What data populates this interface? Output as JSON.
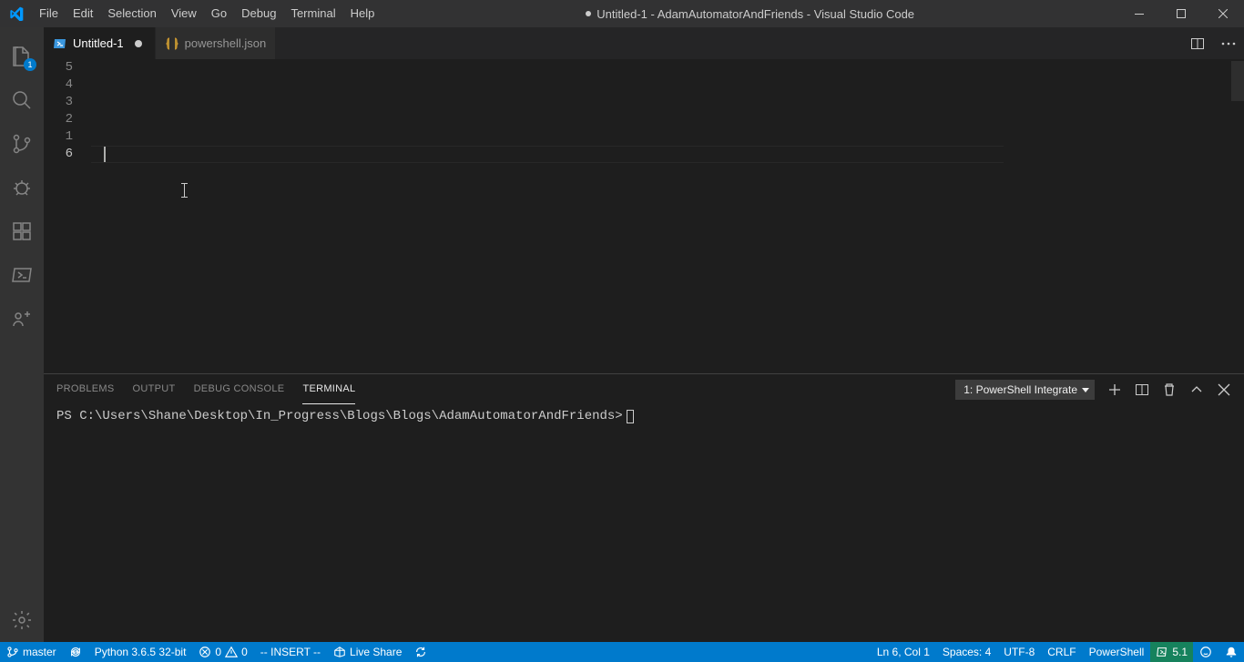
{
  "title_bar": {
    "menus": [
      "File",
      "Edit",
      "Selection",
      "View",
      "Go",
      "Debug",
      "Terminal",
      "Help"
    ],
    "title": "Untitled-1 - AdamAutomatorAndFriends - Visual Studio Code",
    "modified": true
  },
  "activity_bar": {
    "items": [
      {
        "name": "explorer-icon",
        "badge": "1"
      },
      {
        "name": "search-icon",
        "badge": null
      },
      {
        "name": "source-control-icon",
        "badge": null
      },
      {
        "name": "debug-icon",
        "badge": null
      },
      {
        "name": "extensions-icon",
        "badge": null
      },
      {
        "name": "powershell-icon",
        "badge": null
      },
      {
        "name": "live-share-icon",
        "badge": null
      }
    ],
    "bottom": [
      {
        "name": "settings-gear-icon"
      }
    ]
  },
  "tabs": [
    {
      "label": "Untitled-1",
      "icon": "powershell-file-icon",
      "active": true,
      "modified": true
    },
    {
      "label": "powershell.json",
      "icon": "json-file-icon",
      "active": false,
      "modified": false
    }
  ],
  "editor": {
    "line_numbers": [
      "5",
      "4",
      "3",
      "2",
      "1",
      "6"
    ],
    "current_line_index": 5
  },
  "panel": {
    "tabs": [
      "PROBLEMS",
      "OUTPUT",
      "DEBUG CONSOLE",
      "TERMINAL"
    ],
    "active_tab": "TERMINAL",
    "terminal_selector": "1: PowerShell Integrate",
    "terminal_prompt": "PS C:\\Users\\Shane\\Desktop\\In_Progress\\Blogs\\Blogs\\AdamAutomatorAndFriends>"
  },
  "status_bar": {
    "left": {
      "branch": "master",
      "python": "Python 3.6.5 32-bit",
      "errors": "0",
      "warnings": "0",
      "vim_mode": "-- INSERT --",
      "live_share": "Live Share"
    },
    "right": {
      "position": "Ln 6, Col 1",
      "spaces": "Spaces: 4",
      "encoding": "UTF-8",
      "eol": "CRLF",
      "language": "PowerShell",
      "ps_version": "5.1"
    }
  }
}
